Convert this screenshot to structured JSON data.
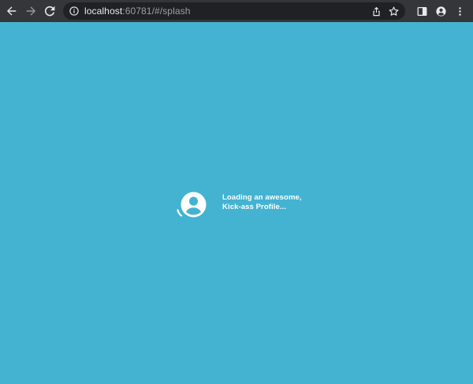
{
  "browser": {
    "url_host": "localhost",
    "url_rest": ":60781/#/splash",
    "icons": {
      "back": "back-arrow-icon",
      "forward": "forward-arrow-icon",
      "reload": "reload-icon",
      "site_info": "info-icon",
      "share": "share-icon",
      "bookmark": "star-icon",
      "side_panel": "side-panel-icon",
      "profile": "profile-icon",
      "menu": "kebab-menu-icon"
    },
    "colors": {
      "toolbar": "#35363a",
      "omnibox": "#202124"
    }
  },
  "page": {
    "background": "#44b3d1",
    "loading_line1": "Loading an awesome,",
    "loading_line2": "Kick-ass Profile..."
  }
}
